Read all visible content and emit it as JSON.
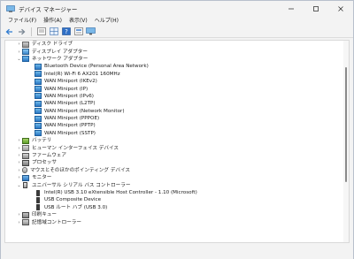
{
  "window": {
    "title": "デバイス マネージャー"
  },
  "menu": [
    "ファイル(F)",
    "操作(A)",
    "表示(V)",
    "ヘルプ(H)"
  ],
  "tree": [
    {
      "level": 0,
      "expander": "›",
      "icon": "disk-drive-icon",
      "iconClass": "i-disk",
      "label": "ディスク ドライブ"
    },
    {
      "level": 0,
      "expander": "›",
      "icon": "display-adapter-icon",
      "iconClass": "i-display",
      "label": "ディスプレイ アダプター"
    },
    {
      "level": 0,
      "expander": "⌄",
      "icon": "network-adapter-icon",
      "iconClass": "i-net",
      "label": "ネットワーク アダプター"
    },
    {
      "level": 1,
      "expander": "",
      "icon": "network-adapter-icon",
      "iconClass": "i-net",
      "label": "Bluetooth Device (Personal Area Network)"
    },
    {
      "level": 1,
      "expander": "",
      "icon": "network-adapter-icon",
      "iconClass": "i-net",
      "label": "Intel(R) Wi-Fi 6 AX201 160MHz"
    },
    {
      "level": 1,
      "expander": "",
      "icon": "network-adapter-icon",
      "iconClass": "i-net",
      "label": "WAN Miniport (IKEv2)"
    },
    {
      "level": 1,
      "expander": "",
      "icon": "network-adapter-icon",
      "iconClass": "i-net",
      "label": "WAN Miniport (IP)"
    },
    {
      "level": 1,
      "expander": "",
      "icon": "network-adapter-icon",
      "iconClass": "i-net",
      "label": "WAN Miniport (IPv6)"
    },
    {
      "level": 1,
      "expander": "",
      "icon": "network-adapter-icon",
      "iconClass": "i-net",
      "label": "WAN Miniport (L2TP)"
    },
    {
      "level": 1,
      "expander": "",
      "icon": "network-adapter-icon",
      "iconClass": "i-net",
      "label": "WAN Miniport (Network Monitor)"
    },
    {
      "level": 1,
      "expander": "",
      "icon": "network-adapter-icon",
      "iconClass": "i-net",
      "label": "WAN Miniport (PPPOE)"
    },
    {
      "level": 1,
      "expander": "",
      "icon": "network-adapter-icon",
      "iconClass": "i-net",
      "label": "WAN Miniport (PPTP)"
    },
    {
      "level": 1,
      "expander": "",
      "icon": "network-adapter-icon",
      "iconClass": "i-net",
      "label": "WAN Miniport (SSTP)"
    },
    {
      "level": 0,
      "expander": "›",
      "icon": "battery-icon",
      "iconClass": "i-batt",
      "label": "バッテリ"
    },
    {
      "level": 0,
      "expander": "›",
      "icon": "hid-icon",
      "iconClass": "i-hid",
      "label": "ヒューマン インターフェイス デバイス"
    },
    {
      "level": 0,
      "expander": "›",
      "icon": "firmware-icon",
      "iconClass": "i-fw",
      "label": "ファームウェア"
    },
    {
      "level": 0,
      "expander": "›",
      "icon": "processor-icon",
      "iconClass": "i-cpu",
      "label": "プロセッサ"
    },
    {
      "level": 0,
      "expander": "›",
      "icon": "mouse-icon",
      "iconClass": "i-mouse",
      "label": "マウスとそのほかのポインティング デバイス"
    },
    {
      "level": 0,
      "expander": "›",
      "icon": "monitor-icon",
      "iconClass": "i-mon",
      "label": "モニター"
    },
    {
      "level": 0,
      "expander": "⌄",
      "icon": "usb-controller-icon",
      "iconClass": "i-usbctrl",
      "label": "ユニバーサル シリアル バス コントローラー"
    },
    {
      "level": 1,
      "expander": "",
      "icon": "usb-icon",
      "iconClass": "i-usb",
      "label": "Intel(R) USB 3.10 eXtensible Host Controller - 1.10 (Microsoft)"
    },
    {
      "level": 1,
      "expander": "",
      "icon": "usb-icon",
      "iconClass": "i-usb",
      "label": "USB Composite Device"
    },
    {
      "level": 1,
      "expander": "",
      "icon": "usb-icon",
      "iconClass": "i-usb",
      "label": "USB ルート ハブ (USB 3.0)"
    },
    {
      "level": 0,
      "expander": "›",
      "icon": "print-queue-icon",
      "iconClass": "i-dev",
      "label": "印刷キュー"
    },
    {
      "level": 0,
      "expander": "›",
      "icon": "storage-controller-icon",
      "iconClass": "i-store",
      "label": "記憶域コントローラー"
    }
  ]
}
